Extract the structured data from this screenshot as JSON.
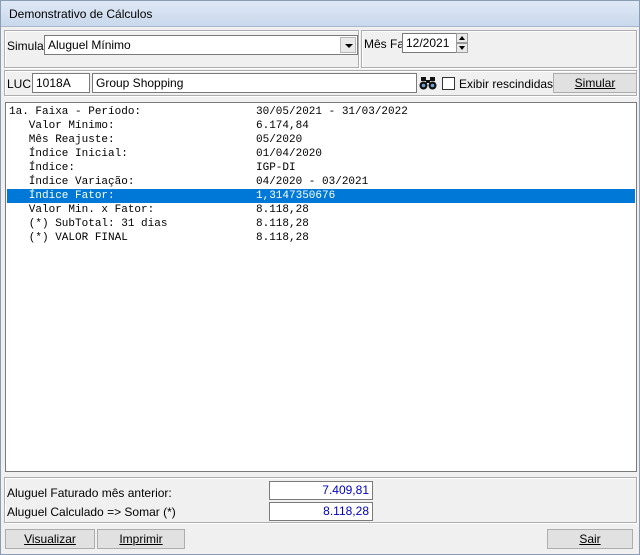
{
  "window": {
    "title": "Demonstrativo de Cálculos"
  },
  "filters": {
    "simular_label": "Simular",
    "simular_value": "Aluguel Mínimo",
    "mes_fat_label": "Mês Fat",
    "mes_fat_value": "12/2021"
  },
  "luc": {
    "label": "LUC",
    "code": "1018A",
    "name": "Group Shopping",
    "search_icon": "binoculars-icon",
    "checkbox_label": "Exibir rescindidas",
    "checkbox_checked": false,
    "simular_button": "Simular"
  },
  "memo": {
    "rows": [
      {
        "label": "1a. Faixa - Período:",
        "value": "30/05/2021 - 31/03/2022"
      },
      {
        "label": "   Valor Mínimo:",
        "value": "6.174,84"
      },
      {
        "label": "   Mês Reajuste:",
        "value": "05/2020"
      },
      {
        "label": "   Índice Inicial:",
        "value": "01/04/2020"
      },
      {
        "label": "   Índice:",
        "value": "IGP-DI"
      },
      {
        "label": "   Índice Variação:",
        "value": "04/2020 - 03/2021"
      },
      {
        "label": "   Índice Fator:",
        "value": "1,3147350676"
      },
      {
        "label": "   Valor Min. x Fator:",
        "value": "8.118,28"
      },
      {
        "label": "   (*) SubTotal: 31 dias",
        "value": "8.118,28"
      },
      {
        "label": "   (*) VALOR FINAL",
        "value": "8.118,28"
      }
    ],
    "selected_index": 6
  },
  "totals": {
    "anterior_label": "Aluguel Faturado mês anterior:",
    "anterior_value": "7.409,81",
    "calculado_label": "Aluguel Calculado => Somar (*)",
    "calculado_value": "8.118,28"
  },
  "footer": {
    "visualizar": "Visualizar",
    "imprimir": "Imprimir",
    "sair": "Sair"
  },
  "colors": {
    "selection": "#0078d7",
    "value_text": "#0000c0"
  }
}
